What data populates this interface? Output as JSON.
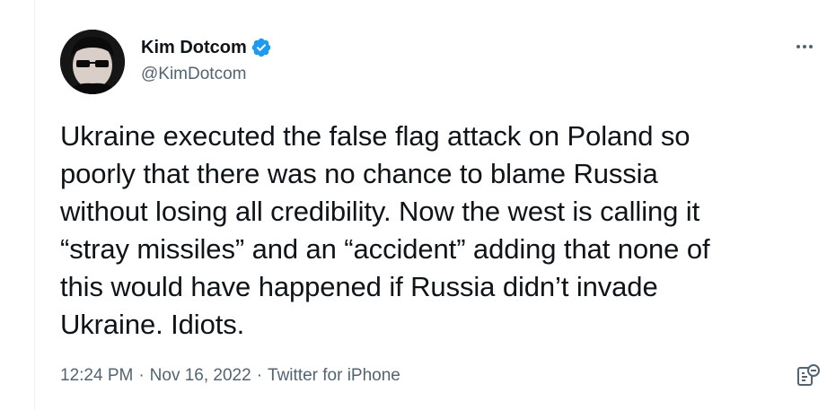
{
  "author": {
    "display_name": "Kim Dotcom",
    "handle": "@KimDotcom",
    "verified": true
  },
  "tweet": {
    "text": "Ukraine executed the false flag attack on Poland so\npoorly that there was no chance to blame Russia\nwithout losing all credibility. Now the west is calling it\n“stray missiles” and an “accident” adding that none of\nthis would have happened if Russia didn’t invade\nUkraine. Idiots."
  },
  "meta": {
    "time": "12:24 PM",
    "separator": "·",
    "date": "Nov 16, 2022",
    "source": "Twitter for iPhone"
  },
  "icons": {
    "verified": "verified-badge-icon",
    "more": "more-options-icon",
    "analytics": "analytics-icon"
  },
  "colors": {
    "verified_blue": "#1d9bf0",
    "secondary_text": "#536471",
    "primary_text": "#0f1419"
  }
}
